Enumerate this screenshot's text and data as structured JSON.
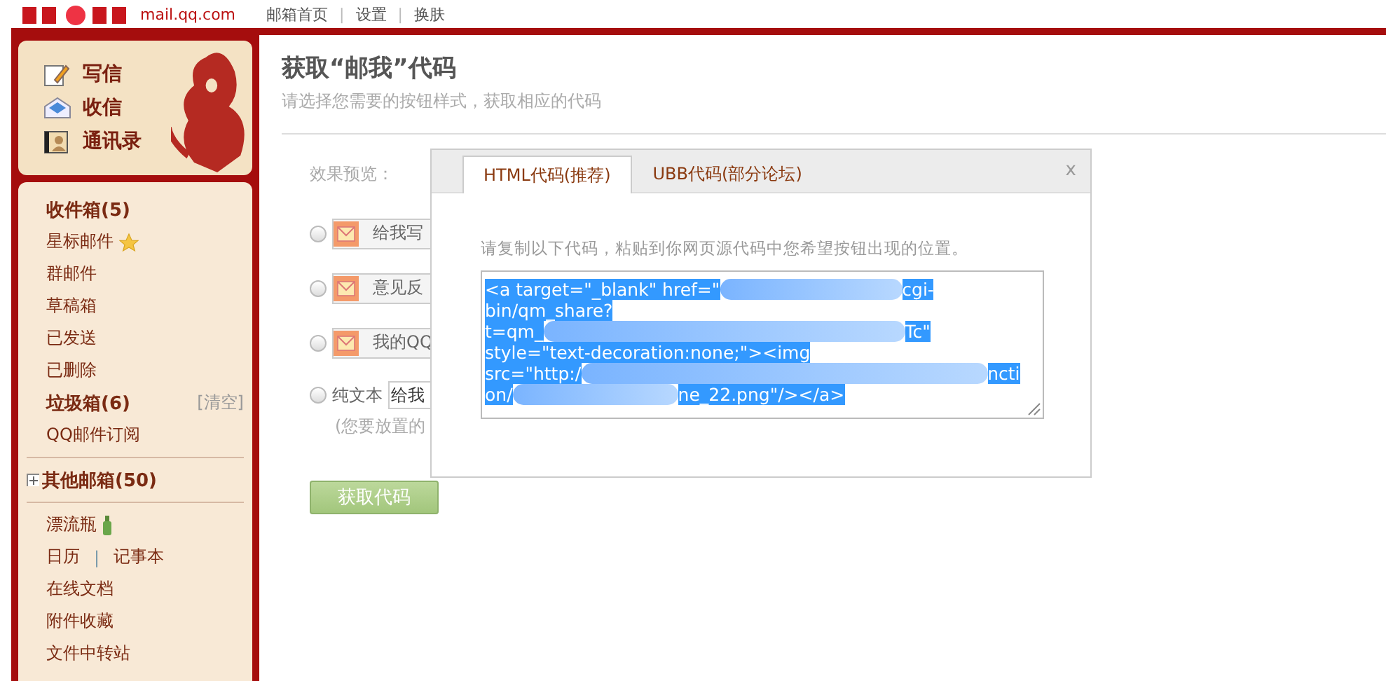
{
  "header": {
    "domain": "mail.qq.com",
    "links": [
      "邮箱首页",
      "设置",
      "换肤"
    ],
    "separator": "|"
  },
  "sidebar": {
    "actions": [
      {
        "label": "写信",
        "kind": "compose"
      },
      {
        "label": "收信",
        "kind": "inbox"
      },
      {
        "label": "通讯录",
        "kind": "contacts"
      }
    ],
    "folders": [
      {
        "label": "收件箱(5)",
        "kind": "folder",
        "bold": true
      },
      {
        "label": "星标邮件",
        "kind": "star",
        "bold": false
      },
      {
        "label": "群邮件",
        "kind": "folder",
        "bold": false
      },
      {
        "label": "草稿箱",
        "kind": "folder",
        "bold": false
      },
      {
        "label": "已发送",
        "kind": "folder",
        "bold": false
      },
      {
        "label": "已删除",
        "kind": "folder",
        "bold": false
      },
      {
        "label": "垃圾箱(6)",
        "kind": "folder",
        "bold": true,
        "action": "[清空]"
      },
      {
        "label": "QQ邮件订阅",
        "kind": "folder",
        "bold": false
      },
      {
        "kind": "divider"
      },
      {
        "label": "其他邮箱(50)",
        "kind": "expander",
        "bold": true,
        "expanded": false
      },
      {
        "kind": "divider"
      },
      {
        "label": "漂流瓶",
        "kind": "bottle",
        "bold": false
      },
      {
        "label": "日历",
        "kind": "pair",
        "second": "记事本",
        "separator": "|",
        "bold": false
      },
      {
        "label": "在线文档",
        "kind": "folder",
        "bold": false
      },
      {
        "label": "附件收藏",
        "kind": "folder",
        "bold": false
      },
      {
        "label": "文件中转站",
        "kind": "folder",
        "bold": false
      }
    ]
  },
  "main": {
    "title": "获取“邮我”代码",
    "subtitle": "请选择您需要的按钮样式，获取相应的代码",
    "preview_label": "效果预览：",
    "options": [
      {
        "kind": "button",
        "label": "给我写",
        "selected": false
      },
      {
        "kind": "button",
        "label": "意见反",
        "selected": false
      },
      {
        "kind": "button",
        "label": "我的QQ",
        "selected": false
      },
      {
        "kind": "text",
        "label": "纯文本",
        "value": "给我",
        "selected": false
      }
    ],
    "note": "(您要放置的",
    "submit": "获取代码"
  },
  "dialog": {
    "tabs": [
      {
        "label": "HTML代码(推荐)",
        "selected": true
      },
      {
        "label": "UBB代码(部分论坛)",
        "selected": false
      }
    ],
    "close": "x",
    "instruction": "请复制以下代码，粘贴到你网页源代码中您希望按钮出现的位置。",
    "code_lines": [
      [
        {
          "text": "<a target=\"_blank\" href=\""
        },
        {
          "kind": "redacted"
        },
        {
          "text": "cgi-"
        }
      ],
      [
        {
          "text": "bin/qm_share?"
        }
      ],
      [
        {
          "text": "t=qm_"
        },
        {
          "kind": "redacted"
        },
        {
          "text": "Tc\""
        }
      ],
      [
        {
          "text": "style=\"text-decoration:none;\"><img"
        }
      ],
      [
        {
          "text": "src=\"http:/"
        },
        {
          "kind": "redacted"
        },
        {
          "text": "ncti"
        }
      ],
      [
        {
          "text": "on/"
        },
        {
          "kind": "redacted"
        },
        {
          "text": "ne_22.png\"/></a>"
        }
      ]
    ]
  }
}
